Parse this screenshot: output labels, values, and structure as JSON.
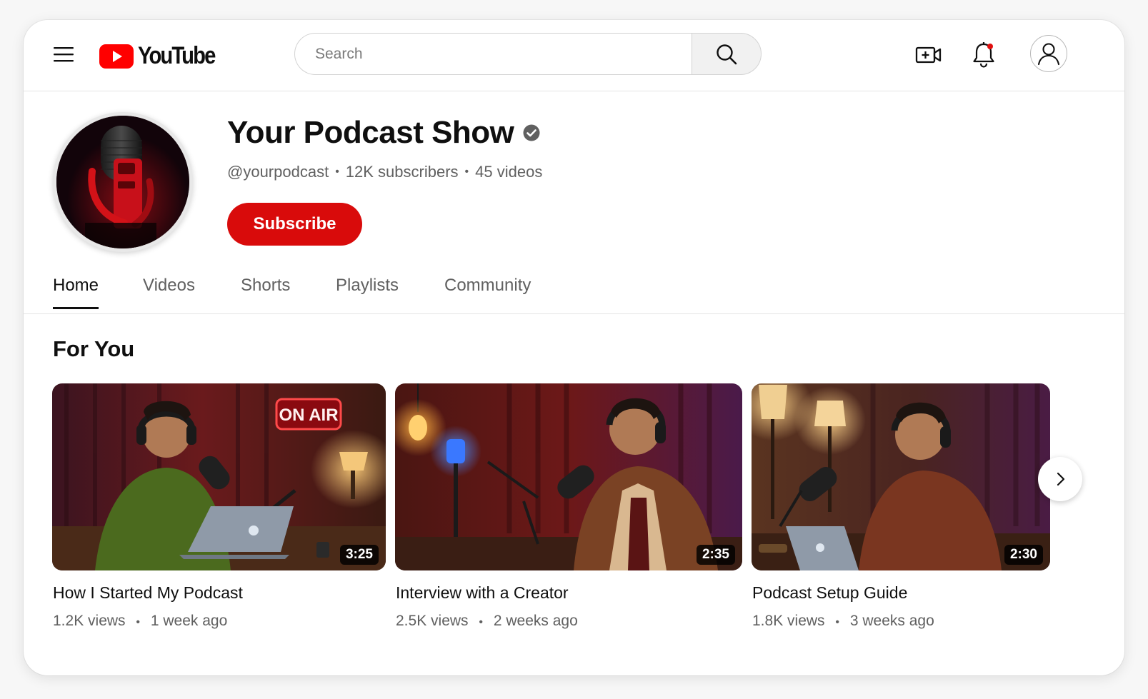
{
  "header": {
    "logo_text": "YouTube",
    "search_placeholder": "Search"
  },
  "icons": {
    "menu": "hamburger-menu-icon",
    "search": "search-icon",
    "create": "create-video-icon",
    "notifications": "bell-icon",
    "account": "account-icon",
    "verified": "verified-check-icon",
    "next": "chevron-right-icon"
  },
  "colors": {
    "brand_red": "#d90b0b",
    "text_primary": "#0f0f0f",
    "text_secondary": "#606060",
    "notification_dot": "#e10e0e"
  },
  "channel": {
    "name": "Your Podcast Show",
    "handle": "@yourpodcast",
    "subscribers": "12K subscribers",
    "videos": "45 videos",
    "subscribe_label": "Subscribe"
  },
  "tabs": [
    {
      "label": "Home",
      "active": true
    },
    {
      "label": "Videos",
      "active": false
    },
    {
      "label": "Shorts",
      "active": false
    },
    {
      "label": "Playlists",
      "active": false
    },
    {
      "label": "Community",
      "active": false
    }
  ],
  "section": {
    "title": "For You"
  },
  "videos": [
    {
      "title": "How I Started My Podcast",
      "views": "1.2K views",
      "age": "1 week ago",
      "duration": "3:25",
      "sign_text": "ON AIR"
    },
    {
      "title": "Interview with a Creator",
      "views": "2.5K views",
      "age": "2 weeks ago",
      "duration": "2:35"
    },
    {
      "title": "Podcast Setup Guide",
      "views": "1.8K views",
      "age": "3 weeks ago",
      "duration": "2:30"
    }
  ]
}
